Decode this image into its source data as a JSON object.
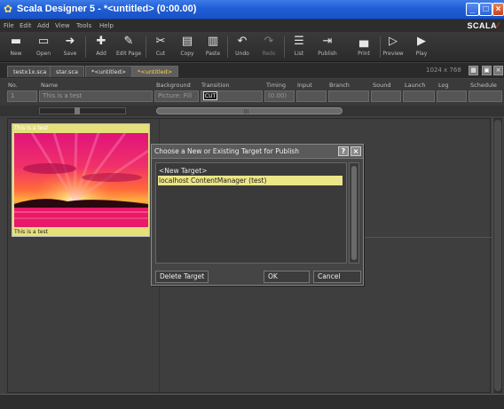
{
  "window": {
    "title": "Scala Designer 5 - *<untitled> (0:00.00)",
    "brand": "SCALA",
    "min_label": "_",
    "max_label": "□",
    "close_label": "×"
  },
  "menu": [
    "File",
    "Edit",
    "Add",
    "View",
    "Tools",
    "Help"
  ],
  "toolbar": [
    {
      "label": "New",
      "icon": "new-icon",
      "glyph": "▬",
      "enabled": true
    },
    {
      "label": "Open",
      "icon": "open-icon",
      "glyph": "▭",
      "enabled": true
    },
    {
      "label": "Save",
      "icon": "save-icon",
      "glyph": "➜",
      "enabled": true
    },
    {
      "label": "Add",
      "icon": "add-icon",
      "glyph": "✚",
      "enabled": true
    },
    {
      "label": "Edit Page",
      "icon": "edit-page-icon",
      "glyph": "✎",
      "enabled": true
    },
    {
      "label": "Cut",
      "icon": "cut-icon",
      "glyph": "✂",
      "enabled": true
    },
    {
      "label": "Copy",
      "icon": "copy-icon",
      "glyph": "▤",
      "enabled": true
    },
    {
      "label": "Paste",
      "icon": "paste-icon",
      "glyph": "▥",
      "enabled": true
    },
    {
      "label": "Undo",
      "icon": "undo-icon",
      "glyph": "↶",
      "enabled": true
    },
    {
      "label": "Redo",
      "icon": "redo-icon",
      "glyph": "↷",
      "enabled": false
    },
    {
      "label": "List",
      "icon": "list-icon",
      "glyph": "☰",
      "enabled": true
    },
    {
      "label": "Publish",
      "icon": "publish-icon",
      "glyph": "⇥",
      "enabled": true
    },
    {
      "label": "Print",
      "icon": "print-icon",
      "glyph": "▄",
      "enabled": true
    },
    {
      "label": "Preview",
      "icon": "preview-icon",
      "glyph": "▷",
      "enabled": true
    },
    {
      "label": "Play",
      "icon": "play-icon",
      "glyph": "▶",
      "enabled": true
    }
  ],
  "tabs": [
    {
      "label": "testx1x.sca",
      "active": false
    },
    {
      "label": "star.sca",
      "active": false
    },
    {
      "label": "*<untitled>",
      "active": false
    },
    {
      "label": "*<untitled>",
      "active": true
    }
  ],
  "resolution": "1024 x 768",
  "columns": {
    "no": "No.",
    "name": "Name",
    "background": "Background",
    "transition": "Transition",
    "timing": "Timing",
    "input": "Input",
    "branch": "Branch",
    "sound": "Sound",
    "launch": "Launch",
    "log": "Log",
    "schedule": "Schedule"
  },
  "row": {
    "no": "1",
    "name": "This is a test",
    "background": "Picture: Fill",
    "transition": "CUT",
    "timing": "(0.00)"
  },
  "thumbnail": {
    "title": "This is a test",
    "caption": "This is a test"
  },
  "dialog": {
    "title": "Choose a New or Existing Target for Publish",
    "help_label": "?",
    "close_label": "×",
    "items": [
      {
        "label": "<New Target>",
        "selected": false
      },
      {
        "label": "localhost ContentManager (test)",
        "selected": true
      }
    ],
    "delete_label": "Delete Target",
    "ok_label": "OK",
    "cancel_label": "Cancel"
  }
}
